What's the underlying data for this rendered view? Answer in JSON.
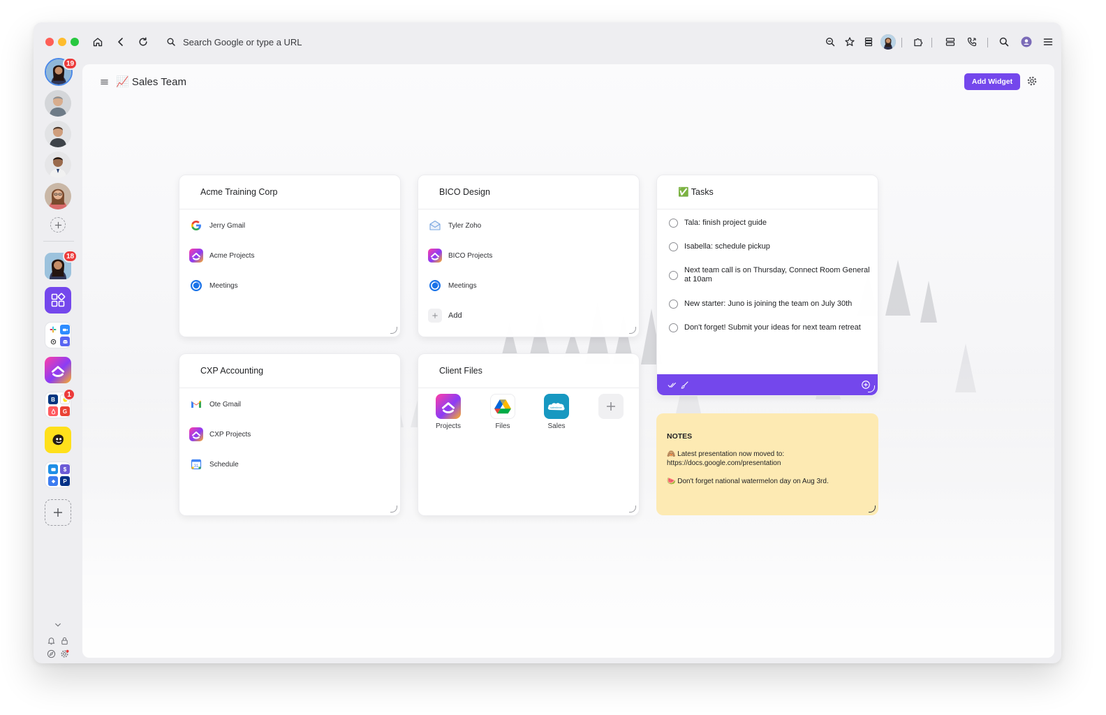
{
  "browser": {
    "url_placeholder": "Search Google or type a URL"
  },
  "sidebar": {
    "top_avatar_badge": "19",
    "app_avatar_badge": "18",
    "cluster_badge": "1"
  },
  "panel": {
    "title": "📈 Sales Team",
    "add_widget_label": "Add Widget"
  },
  "widgets": {
    "acme": {
      "title": "Acme Training Corp",
      "items": [
        {
          "label": "Jerry Gmail",
          "icon": "google-icon"
        },
        {
          "label": "Acme Projects",
          "icon": "clickup-icon"
        },
        {
          "label": "Meetings",
          "icon": "calendar-icon"
        }
      ]
    },
    "bico": {
      "title": "BICO Design",
      "items": [
        {
          "label": "Tyler Zoho",
          "icon": "mail-icon"
        },
        {
          "label": "BICO Projects",
          "icon": "clickup-icon"
        },
        {
          "label": "Meetings",
          "icon": "calendar-icon"
        }
      ],
      "add_label": "Add"
    },
    "cxp": {
      "title": "CXP Accounting",
      "items": [
        {
          "label": "Ote Gmail",
          "icon": "gmail-icon"
        },
        {
          "label": "CXP Projects",
          "icon": "clickup-icon"
        },
        {
          "label": "Schedule",
          "icon": "google-calendar-icon"
        }
      ]
    },
    "client_files": {
      "title": "Client Files",
      "apps": [
        {
          "label": "Projects",
          "icon": "clickup-icon"
        },
        {
          "label": "Files",
          "icon": "google-drive-icon"
        },
        {
          "label": "Sales",
          "icon": "salesforce-icon",
          "logo_text": "salesforce"
        }
      ]
    },
    "tasks": {
      "title": "✅ Tasks",
      "items": [
        "Tala: finish project guide",
        "Isabella: schedule pickup",
        "Next team call is on Thursday, Connect Room General at 10am",
        "New starter: Juno is joining the team on July 30th",
        "Don't forget! Submit your ideas for next team retreat"
      ]
    },
    "notes": {
      "heading": "NOTES",
      "line1": "🙈 Latest presentation now moved to:",
      "line2": "https://docs.google.com/presentation",
      "line3": "🍉 Don't forget national watermelon day on Aug 3rd."
    }
  },
  "colors": {
    "accent": "#7447ec",
    "notes_bg": "#fdeab3",
    "badge": "#ec3b3b"
  }
}
